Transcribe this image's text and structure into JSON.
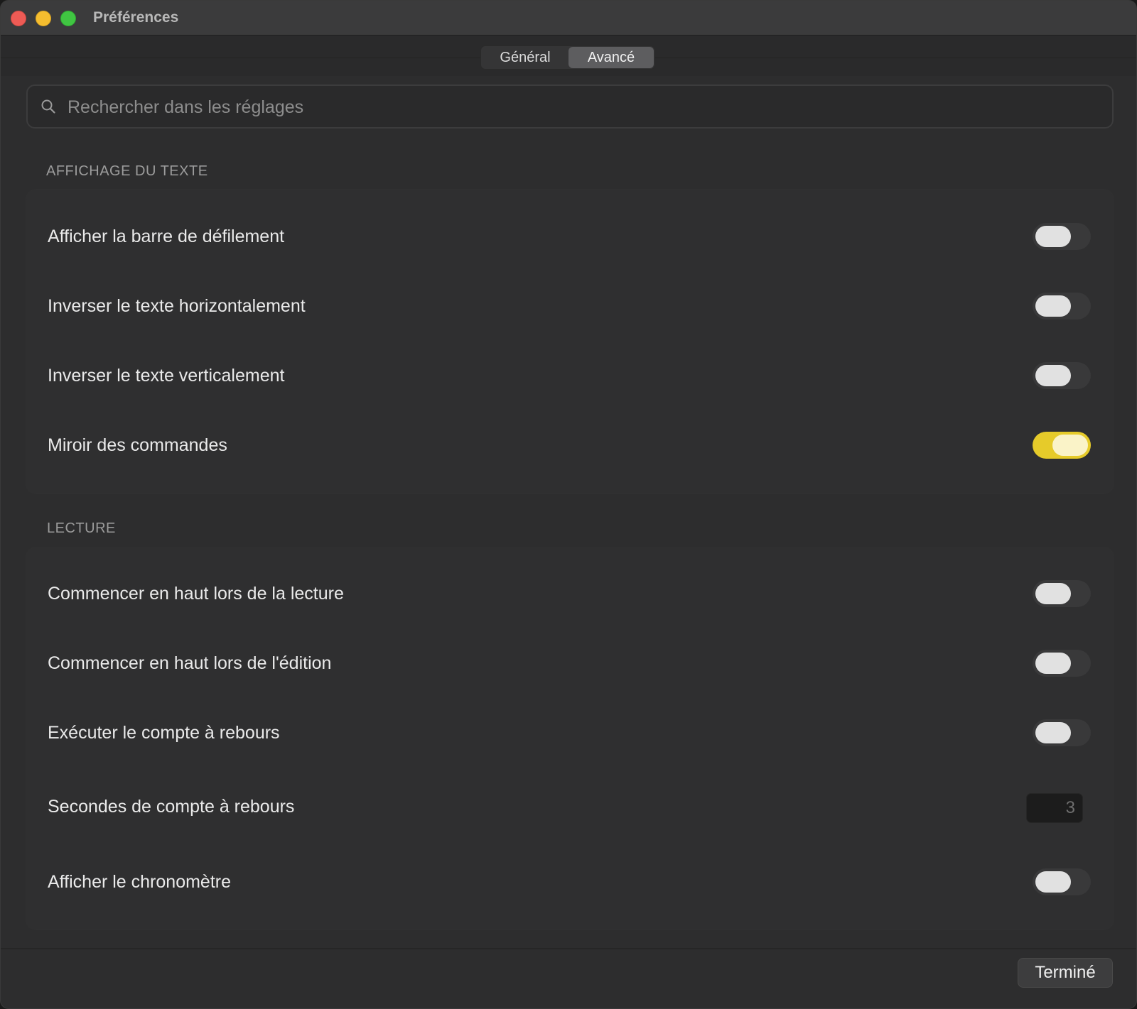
{
  "window": {
    "title": "Préférences"
  },
  "tabs": [
    {
      "label": "Général",
      "selected": false
    },
    {
      "label": "Avancé",
      "selected": true
    }
  ],
  "search": {
    "placeholder": "Rechercher dans les réglages",
    "value": ""
  },
  "sections": [
    {
      "title": "AFFICHAGE DU TEXTE",
      "rows": [
        {
          "label": "Afficher la barre de défilement",
          "control": "toggle",
          "on": false
        },
        {
          "label": "Inverser le texte horizontalement",
          "control": "toggle",
          "on": false
        },
        {
          "label": "Inverser le texte verticalement",
          "control": "toggle",
          "on": false
        },
        {
          "label": "Miroir des commandes",
          "control": "toggle",
          "on": true
        }
      ]
    },
    {
      "title": "LECTURE",
      "rows": [
        {
          "label": "Commencer en haut lors de la lecture",
          "control": "toggle",
          "on": false
        },
        {
          "label": "Commencer en haut lors de l'édition",
          "control": "toggle",
          "on": false
        },
        {
          "label": "Exécuter le compte à rebours",
          "control": "toggle",
          "on": false
        },
        {
          "label": "Secondes de compte à rebours",
          "control": "number",
          "value": "3"
        },
        {
          "label": "Afficher le chronomètre",
          "control": "toggle",
          "on": false
        }
      ]
    }
  ],
  "footer": {
    "done_label": "Terminé"
  },
  "colors": {
    "accent_toggle_on": "#e6cb2a",
    "window_bg": "#2d2d2e",
    "group_bg": "#2f2f30"
  }
}
